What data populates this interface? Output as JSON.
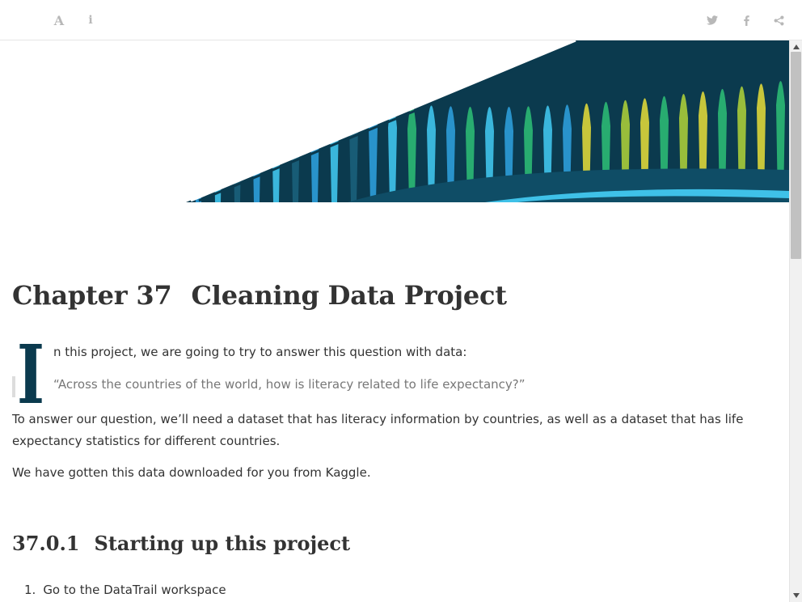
{
  "toolbar": {
    "font_icon_glyph": "A",
    "info_icon_glyph": "i",
    "icons": [
      "font-settings-icon",
      "info-icon",
      "twitter-icon",
      "facebook-icon",
      "share-icon"
    ]
  },
  "banner": {
    "colors": [
      "#0b3a4e",
      "#1a5f7a",
      "#2d9bd6",
      "#3fc1e8",
      "#2bb673",
      "#a6c93a",
      "#d8d23a"
    ]
  },
  "chapter": {
    "number": "Chapter 37",
    "title": "Cleaning Data Project"
  },
  "intro": {
    "drop_cap_letter": "I",
    "first_line": "n this project, we are going to try to answer this question with data:",
    "quote": "“Across the countries of the world, how is literacy related to life expectancy?”",
    "paragraph2": "To answer our question, we’ll need a dataset that has literacy information by countries, as well as a dataset that has life expectancy statistics for different countries.",
    "paragraph3": "We have gotten this data downloaded for you from Kaggle."
  },
  "section": {
    "number": "37.0.1",
    "title": "Starting up this project"
  },
  "steps": [
    {
      "marker": "1.",
      "text": "Go to the DataTrail workspace"
    }
  ],
  "colors": {
    "text": "#333333",
    "quote_text": "#777777",
    "drop_cap": "#0b3a4e",
    "toolbar_icon": "#b8b8b8"
  }
}
